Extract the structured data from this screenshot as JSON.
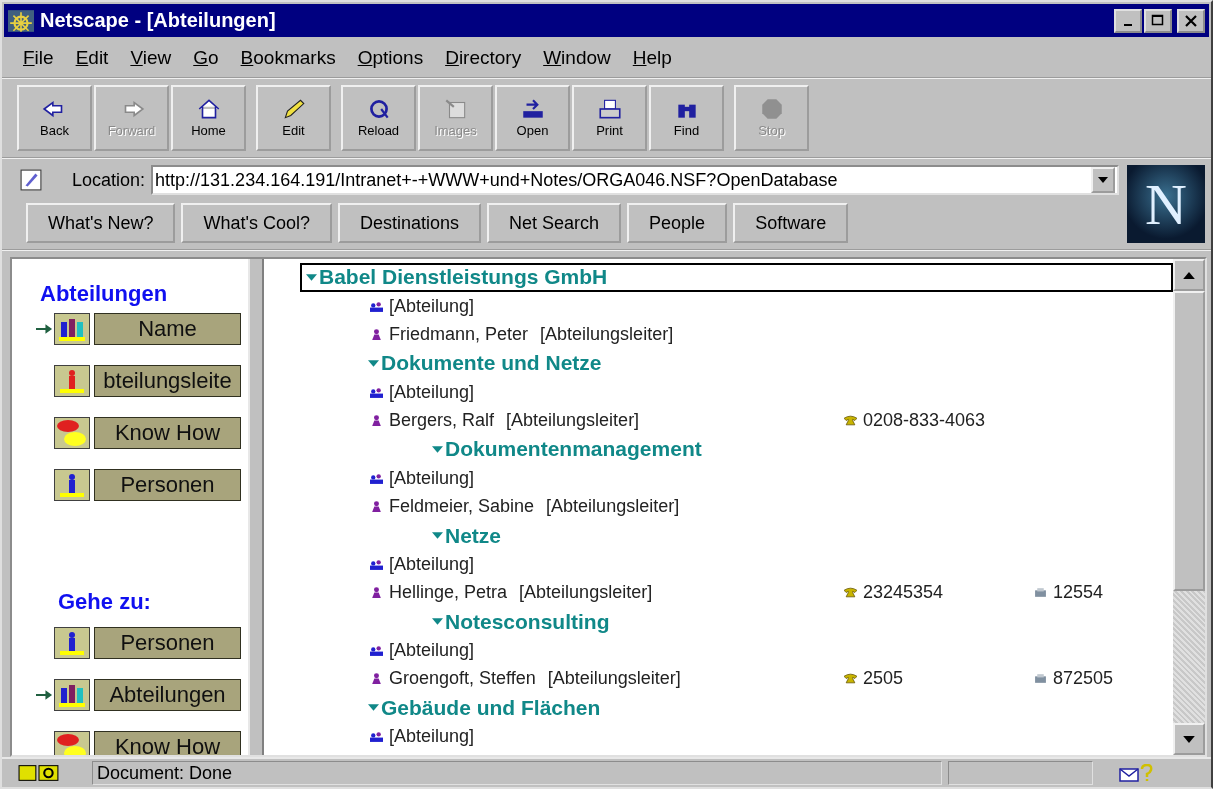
{
  "window": {
    "title": "Netscape - [Abteilungen]"
  },
  "menu": [
    "File",
    "Edit",
    "View",
    "Go",
    "Bookmarks",
    "Options",
    "Directory",
    "Window",
    "Help"
  ],
  "toolbar": [
    [
      {
        "label": "Back",
        "kind": "back",
        "disabled": false
      },
      {
        "label": "Forward",
        "kind": "forward",
        "disabled": true
      },
      {
        "label": "Home",
        "kind": "home",
        "disabled": false
      }
    ],
    [
      {
        "label": "Edit",
        "kind": "edit",
        "disabled": false
      }
    ],
    [
      {
        "label": "Reload",
        "kind": "reload",
        "disabled": false
      },
      {
        "label": "Images",
        "kind": "images",
        "disabled": true
      },
      {
        "label": "Open",
        "kind": "open",
        "disabled": false
      },
      {
        "label": "Print",
        "kind": "print",
        "disabled": false
      },
      {
        "label": "Find",
        "kind": "find",
        "disabled": false
      }
    ],
    [
      {
        "label": "Stop",
        "kind": "stop",
        "disabled": true
      }
    ]
  ],
  "location": {
    "label": "Location:",
    "value": "http://131.234.164.191/Intranet+-+WWW+und+Notes/ORGA046.NSF?OpenDatabase"
  },
  "logo": "N",
  "directory_buttons": [
    "What's New?",
    "What's Cool?",
    "Destinations",
    "Net Search",
    "People",
    "Software"
  ],
  "nav": [
    {
      "heading": "Abteilungen",
      "items": [
        {
          "label": "Name",
          "kind": "group",
          "selected": true
        },
        {
          "label": "bteilungsleite",
          "kind": "leader",
          "selected": false
        },
        {
          "label": "Know How",
          "kind": "knowhow",
          "selected": false
        },
        {
          "label": "Personen",
          "kind": "person",
          "selected": false
        }
      ]
    },
    {
      "heading": "Gehe zu:",
      "items": [
        {
          "label": "Personen",
          "kind": "person",
          "selected": false
        },
        {
          "label": "Abteilungen",
          "kind": "group",
          "selected": true
        },
        {
          "label": "Know How",
          "kind": "knowhow",
          "selected": false
        }
      ]
    }
  ],
  "tree": [
    {
      "title": "Babel Dienstleistungs GmbH",
      "expanded": true,
      "entries": [
        {
          "kind": "department",
          "text": "[Abteilung]"
        },
        {
          "kind": "person",
          "name": "Friedmann, Peter",
          "role": "[Abteilungsleiter]"
        }
      ],
      "children": [
        {
          "title": "Dokumente und Netze",
          "expanded": true,
          "entries": [
            {
              "kind": "department",
              "text": "[Abteilung]"
            },
            {
              "kind": "person",
              "name": "Bergers, Ralf",
              "role": "[Abteilungsleiter]",
              "phone": "0208-833-4063"
            }
          ],
          "children": [
            {
              "title": "Dokumentenmanagement",
              "expanded": true,
              "entries": [
                {
                  "kind": "department",
                  "text": "[Abteilung]"
                },
                {
                  "kind": "person",
                  "name": "Feldmeier, Sabine",
                  "role": "[Abteilungsleiter]"
                }
              ]
            },
            {
              "title": "Netze",
              "expanded": true,
              "entries": [
                {
                  "kind": "department",
                  "text": "[Abteilung]"
                },
                {
                  "kind": "person",
                  "name": "Hellinge, Petra",
                  "role": "[Abteilungsleiter]",
                  "phone": "23245354",
                  "fax": "12554"
                }
              ]
            },
            {
              "title": "Notesconsulting",
              "expanded": true,
              "entries": [
                {
                  "kind": "department",
                  "text": "[Abteilung]"
                },
                {
                  "kind": "person",
                  "name": "Groengoft, Steffen",
                  "role": "[Abteilungsleiter]",
                  "phone": "2505",
                  "fax": "872505"
                }
              ]
            }
          ]
        },
        {
          "title": "Gebäude und Flächen",
          "expanded": true,
          "entries": [
            {
              "kind": "department",
              "text": "[Abteilung]"
            }
          ]
        }
      ]
    }
  ],
  "status_bar": {
    "text": "Document: Done"
  }
}
